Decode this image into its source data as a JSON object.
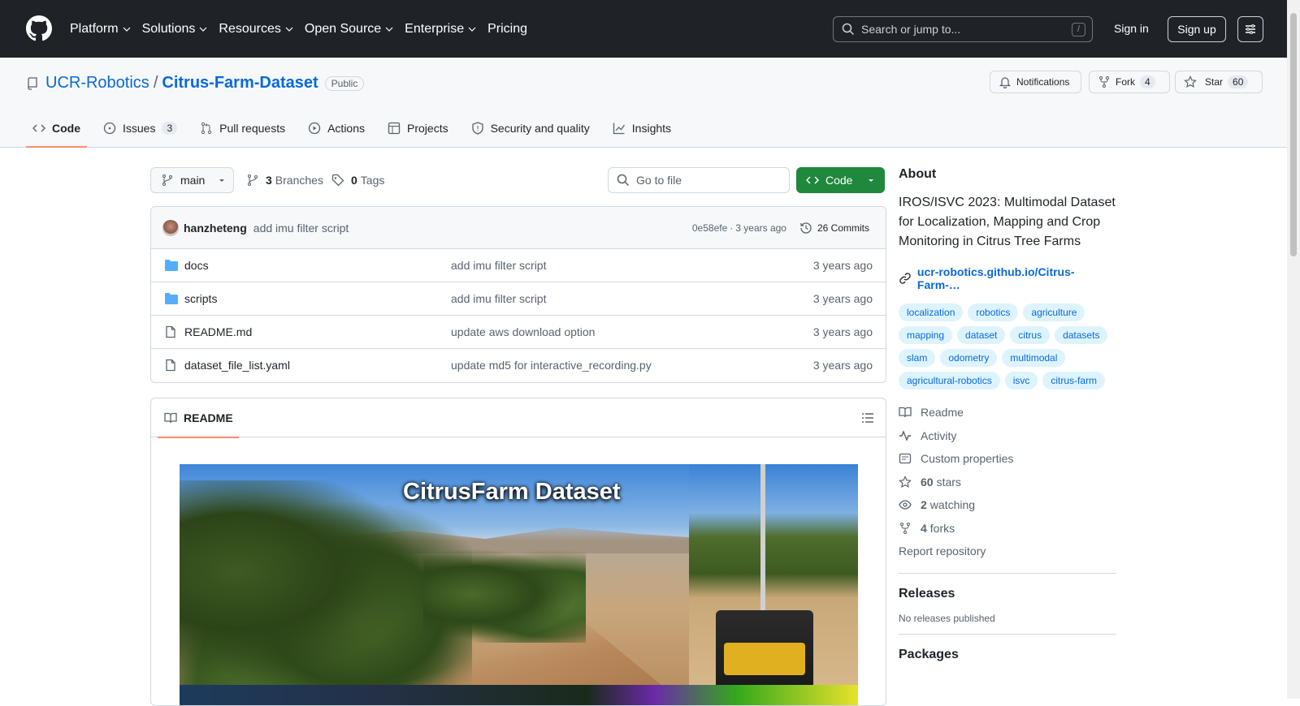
{
  "topnav": {
    "items": [
      "Platform",
      "Solutions",
      "Resources",
      "Open Source",
      "Enterprise"
    ],
    "pricing": "Pricing",
    "search_placeholder": "Search or jump to...",
    "search_shortcut": "/",
    "signin": "Sign in",
    "signup": "Sign up"
  },
  "repo": {
    "owner": "UCR-Robotics",
    "sep": "/",
    "name": "Citrus-Farm-Dataset",
    "visibility": "Public",
    "notifications": "Notifications",
    "fork": "Fork",
    "fork_count": "4",
    "star": "Star",
    "star_count": "60"
  },
  "tabs": [
    {
      "label": "Code"
    },
    {
      "label": "Issues",
      "count": "3"
    },
    {
      "label": "Pull requests"
    },
    {
      "label": "Actions"
    },
    {
      "label": "Projects"
    },
    {
      "label": "Security and quality"
    },
    {
      "label": "Insights"
    }
  ],
  "toolbar": {
    "branch": "main",
    "branches_count": "3",
    "branches_label": "Branches",
    "tags_count": "0",
    "tags_label": "Tags",
    "goto_placeholder": "Go to file",
    "code_label": "Code"
  },
  "commit": {
    "author": "hanzheteng",
    "message": "add imu filter script",
    "hash": "0e58efe",
    "dot": "·",
    "age": "3 years ago",
    "commits": "26 Commits"
  },
  "files": [
    {
      "name": "docs",
      "type": "dir",
      "message": "add imu filter script",
      "age": "3 years ago"
    },
    {
      "name": "scripts",
      "type": "dir",
      "message": "add imu filter script",
      "age": "3 years ago"
    },
    {
      "name": "README.md",
      "type": "file",
      "message": "update aws download option",
      "age": "3 years ago"
    },
    {
      "name": "dataset_file_list.yaml",
      "type": "file",
      "message": "update md5 for interactive_recording.py",
      "age": "3 years ago"
    }
  ],
  "readme": {
    "tab": "README",
    "banner_title": "CitrusFarm Dataset"
  },
  "about": {
    "title": "About",
    "description": "IROS/ISVC 2023: Multimodal Dataset for Localization, Mapping and Crop Monitoring in Citrus Tree Farms",
    "link": "ucr-robotics.github.io/Citrus-Farm-…",
    "topics": [
      "localization",
      "robotics",
      "agriculture",
      "mapping",
      "dataset",
      "citrus",
      "datasets",
      "slam",
      "odometry",
      "multimodal",
      "agricultural-robotics",
      "isvc",
      "citrus-farm"
    ],
    "readme": "Readme",
    "activity": "Activity",
    "custom_properties": "Custom properties",
    "stars_count": "60",
    "stars_label": "stars",
    "watching_count": "2",
    "watching_label": "watching",
    "forks_count": "4",
    "forks_label": "forks",
    "report": "Report repository"
  },
  "releases": {
    "title": "Releases",
    "empty": "No releases published"
  },
  "packages": {
    "title": "Packages"
  },
  "colors": {
    "header_bg": "#1f2328",
    "link": "#0969da",
    "green": "#1f883d",
    "tab_underline": "#fd8c73"
  }
}
